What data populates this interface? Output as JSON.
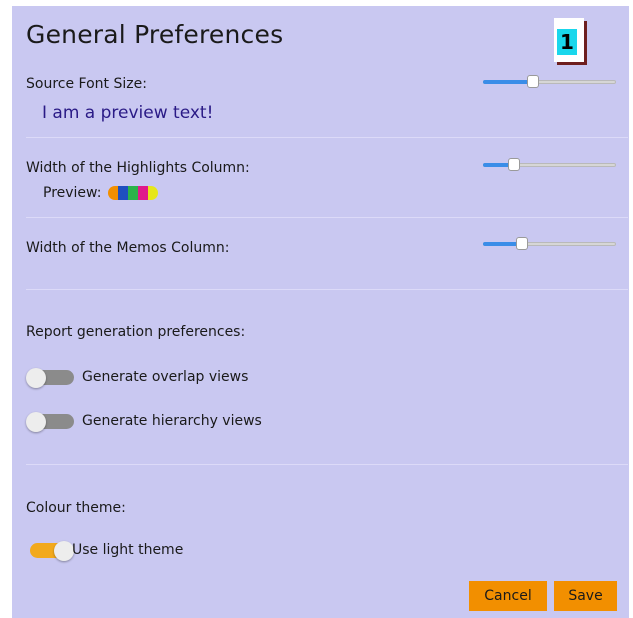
{
  "title": "General Preferences",
  "badge": "1",
  "font_size": {
    "label": "Source Font Size:",
    "preview_text": "I am a preview text!",
    "value_pct": 36
  },
  "highlights": {
    "label": "Width of the Highlights Column:",
    "preview_label": "Preview:",
    "value_pct": 21,
    "colors": [
      "#f28f00",
      "#1f4fbf",
      "#2bb34a",
      "#e01a8c",
      "#e6e61a"
    ]
  },
  "memos": {
    "label": "Width of the Memos Column:",
    "value_pct": 27
  },
  "report": {
    "heading": "Report generation preferences:",
    "overlap_label": "Generate overlap views",
    "overlap_on": false,
    "hierarchy_label": "Generate hierarchy views",
    "hierarchy_on": false
  },
  "theme": {
    "heading": "Colour theme:",
    "light_label": "Use light theme",
    "light_on": true
  },
  "buttons": {
    "cancel": "Cancel",
    "save": "Save"
  },
  "colors": {
    "panel": "#c9c8f1",
    "accent": "#f28f00",
    "toggle_on": "#f2a91c",
    "slider_fill": "#3a8de8"
  }
}
